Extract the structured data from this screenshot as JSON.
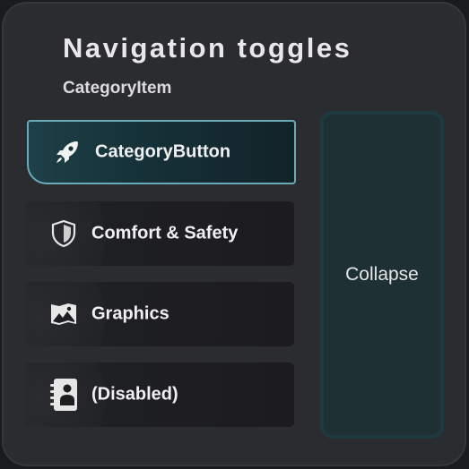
{
  "header": {
    "title": "Navigation toggles",
    "subtitle": "CategoryItem"
  },
  "items": [
    {
      "label": "CategoryButton",
      "icon": "rocket-icon",
      "state": "selected"
    },
    {
      "label": "Comfort & Safety",
      "icon": "shield-icon",
      "state": "normal"
    },
    {
      "label": "Graphics",
      "icon": "landscape-icon",
      "state": "normal"
    },
    {
      "label": "(Disabled)",
      "icon": "contact-card-icon",
      "state": "disabled"
    }
  ],
  "collapse": {
    "label": "Collapse"
  },
  "colors": {
    "panel": "#2b2c30",
    "accent_border": "#6aa9b8",
    "selected_bg": "#153037",
    "collapse_bg": "#1f3034"
  }
}
